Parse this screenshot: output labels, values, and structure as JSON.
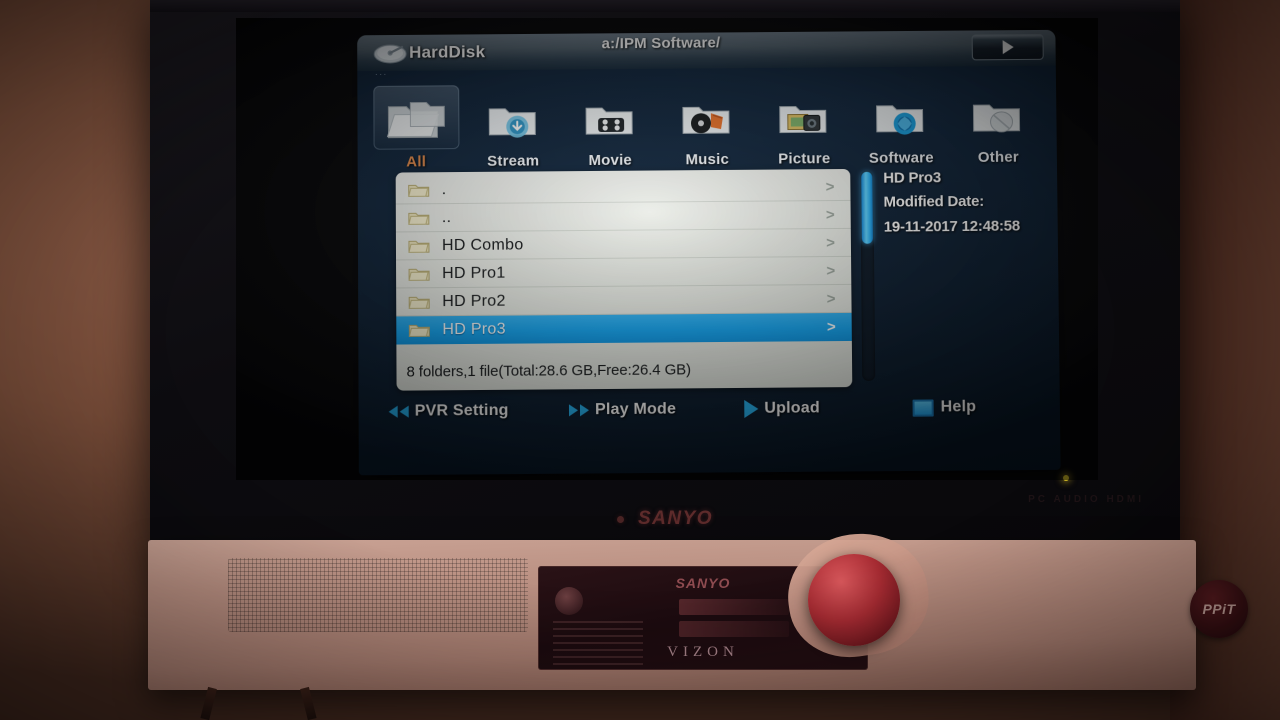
{
  "scene": {
    "tv_brand": "SANYO",
    "tv_ports_label": "PC AUDIO   HDMI",
    "cabinet": {
      "brand": "SANYO",
      "model_name": "VIZON",
      "sticker": "PPiT"
    }
  },
  "osd": {
    "title": "HardDisk",
    "path": "a:/IPM Software/",
    "title_dots": "...",
    "play_button": "play-icon",
    "categories": [
      {
        "label": "All",
        "icon": "folder-all-icon",
        "selected": true
      },
      {
        "label": "Stream",
        "icon": "folder-stream-icon",
        "selected": false
      },
      {
        "label": "Movie",
        "icon": "folder-movie-icon",
        "selected": false
      },
      {
        "label": "Music",
        "icon": "folder-music-icon",
        "selected": false
      },
      {
        "label": "Picture",
        "icon": "folder-picture-icon",
        "selected": false
      },
      {
        "label": "Software",
        "icon": "folder-software-icon",
        "selected": false
      },
      {
        "label": "Other",
        "icon": "folder-other-icon",
        "selected": false
      }
    ],
    "file_list": {
      "rows": [
        {
          "name": ".",
          "chevron": ">",
          "selected": false
        },
        {
          "name": "..",
          "chevron": ">",
          "selected": false
        },
        {
          "name": "HD Combo",
          "chevron": ">",
          "selected": false
        },
        {
          "name": "HD Pro1",
          "chevron": ">",
          "selected": false
        },
        {
          "name": "HD Pro2",
          "chevron": ">",
          "selected": false
        },
        {
          "name": "HD Pro3",
          "chevron": ">",
          "selected": true
        }
      ],
      "status": "8 folders,1 file(Total:28.6 GB,Free:26.4 GB)"
    },
    "info_panel": {
      "name": "HD Pro3",
      "modified_label": "Modified Date:",
      "modified_value": "19-11-2017 12:48:58"
    },
    "toolbar": {
      "pvr_setting": "PVR Setting",
      "play_mode": "Play Mode",
      "upload": "Upload",
      "help": "Help"
    },
    "colors": {
      "selection": "#13a4f0",
      "selected_category": "#e28a4a",
      "accent_arrow": "#25b2f0",
      "panel_bg": "#e7eae4"
    }
  }
}
